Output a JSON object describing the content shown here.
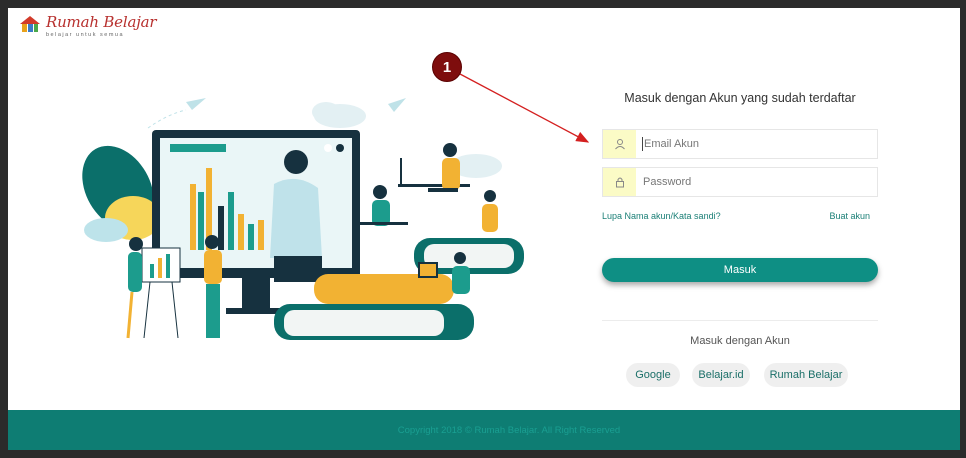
{
  "logo": {
    "title": "Rumah Belajar",
    "subtitle": "belajar untuk semua"
  },
  "login": {
    "title": "Masuk dengan Akun yang sudah terdaftar",
    "email_placeholder": "Email Akun",
    "password_placeholder": "Password",
    "forgot_label": "Lupa Nama akun/Kata sandi?",
    "create_label": "Buat akun",
    "submit_label": "Masuk"
  },
  "alt_login": {
    "title": "Masuk dengan Akun",
    "providers": [
      "Google",
      "Belajar.id",
      "Rumah Belajar"
    ]
  },
  "footer": {
    "copyright": "Copyright 2018 © Rumah Belajar. All Right Reserved"
  },
  "annotation": {
    "badge": "1",
    "color": "#7e0d0d",
    "arrow_color": "#d42020"
  },
  "colors": {
    "accent": "#0e8f84",
    "footer": "#0e7d73",
    "icon_bg": "#fbfbc6"
  }
}
